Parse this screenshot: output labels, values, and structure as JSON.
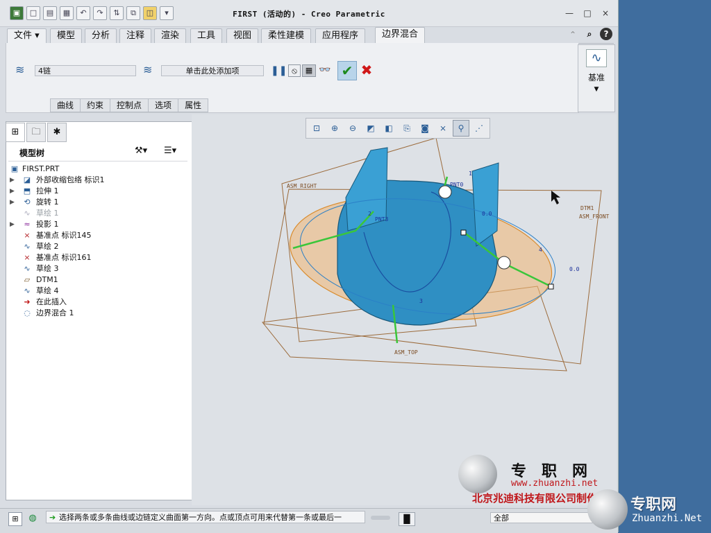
{
  "window": {
    "title": "FIRST (活动的) - Creo Parametric",
    "controls": [
      "—",
      "□",
      "×"
    ]
  },
  "menu_tabs": [
    {
      "label": "文件 ▾"
    },
    {
      "label": "模型"
    },
    {
      "label": "分析"
    },
    {
      "label": "注释"
    },
    {
      "label": "渲染"
    },
    {
      "label": "工具"
    },
    {
      "label": "视图"
    },
    {
      "label": "柔性建模"
    },
    {
      "label": "应用程序"
    },
    {
      "label": "边界混合"
    }
  ],
  "ribbon": {
    "chain_field": "4链",
    "add_item_field": "单击此处添加项",
    "subtabs": [
      "曲线",
      "约束",
      "控制点",
      "选项",
      "属性"
    ],
    "datum_label": "基准"
  },
  "model_tree": {
    "header": "模型树",
    "nodes": [
      {
        "label": "FIRST.PRT",
        "expand": "",
        "icon": "part-icon",
        "glyph": "▣"
      },
      {
        "label": "外部收缩包络 标识1",
        "expand": "▶",
        "icon": "shrinkwrap-icon",
        "glyph": "◪"
      },
      {
        "label": "拉伸 1",
        "expand": "▶",
        "icon": "extrude-icon",
        "glyph": "⬒"
      },
      {
        "label": "旋转 1",
        "expand": "▶",
        "icon": "revolve-icon",
        "glyph": "⟲"
      },
      {
        "label": "草绘 1",
        "expand": "",
        "icon": "sketch-icon",
        "glyph": "∿",
        "grey": true
      },
      {
        "label": "投影 1",
        "expand": "▶",
        "icon": "project-icon",
        "glyph": "≈"
      },
      {
        "label": "基准点 标识145",
        "expand": "",
        "icon": "datum-point-icon",
        "glyph": "×"
      },
      {
        "label": "草绘 2",
        "expand": "",
        "icon": "sketch-icon",
        "glyph": "∿"
      },
      {
        "label": "基准点 标识161",
        "expand": "",
        "icon": "datum-point-icon",
        "glyph": "×"
      },
      {
        "label": "草绘 3",
        "expand": "",
        "icon": "sketch-icon",
        "glyph": "∿"
      },
      {
        "label": "DTM1",
        "expand": "",
        "icon": "datum-plane-icon",
        "glyph": "▱"
      },
      {
        "label": "草绘 4",
        "expand": "",
        "icon": "sketch-icon",
        "glyph": "∿"
      },
      {
        "label": "在此插入",
        "expand": "",
        "icon": "insert-here-icon",
        "glyph": "➜"
      },
      {
        "label": "边界混合 1",
        "expand": "",
        "icon": "boundary-blend-icon",
        "glyph": "◌"
      }
    ]
  },
  "viewport": {
    "plane_labels": [
      "ASM_RIGHT",
      "ASM_FRONT",
      "ASM_TOP",
      "DTM1"
    ],
    "point_labels": [
      "PNT0",
      "PNT3"
    ],
    "chain_labels": [
      "1",
      "2",
      "3",
      "4"
    ],
    "value_labels": [
      "0.0",
      "0.0"
    ]
  },
  "status": {
    "message": "选择两条或多条曲线或边链定义曲面第一方向。点或顶点可用来代替第一条或最后一",
    "filter": "全部"
  },
  "watermark": {
    "brand_cn": "专职网",
    "url": "www.zhuanzhi.net",
    "company": "北京兆迪科技有限公司制作",
    "brand_cn2": "专职网",
    "url2": "Zhuanzhi.Net"
  }
}
